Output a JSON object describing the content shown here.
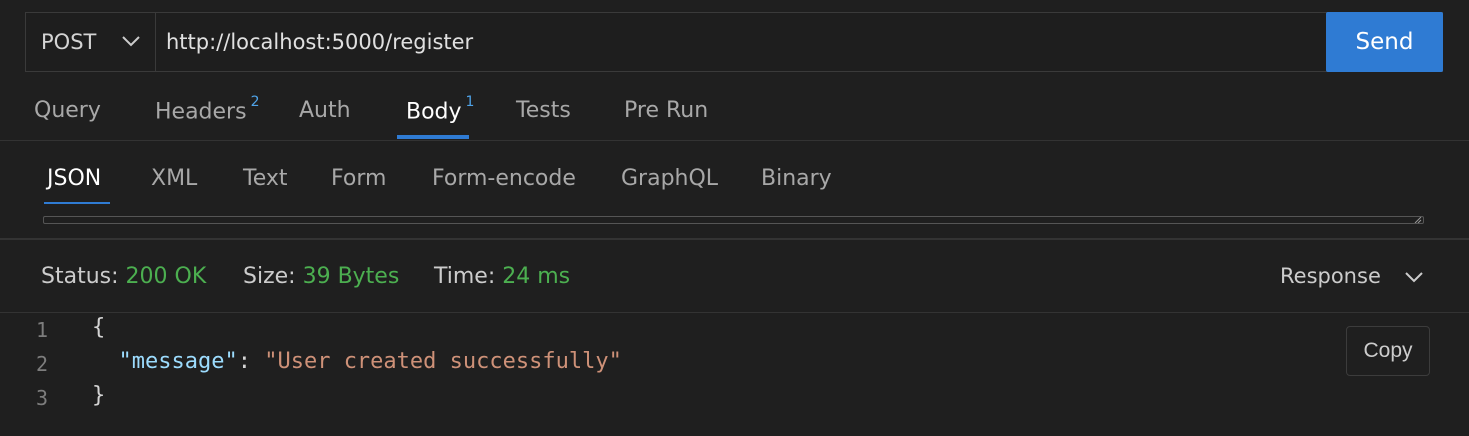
{
  "request": {
    "method": "POST",
    "url": "http://localhost:5000/register",
    "send_label": "Send"
  },
  "tabs": [
    {
      "label": "Query",
      "badge": ""
    },
    {
      "label": "Headers",
      "badge": "2"
    },
    {
      "label": "Auth",
      "badge": ""
    },
    {
      "label": "Body",
      "badge": "1"
    },
    {
      "label": "Tests",
      "badge": ""
    },
    {
      "label": "Pre Run",
      "badge": ""
    }
  ],
  "active_tab": "Body",
  "body_types": [
    "JSON",
    "XML",
    "Text",
    "Form",
    "Form-encode",
    "GraphQL",
    "Binary"
  ],
  "active_body_type": "JSON",
  "response": {
    "status_label": "Status:",
    "status_value": "200 OK",
    "size_label": "Size:",
    "size_value": "39 Bytes",
    "time_label": "Time:",
    "time_value": "24 ms",
    "view_select": "Response",
    "copy_label": "Copy",
    "lines": [
      {
        "num": "1",
        "brace": "{"
      },
      {
        "num": "2",
        "key": "\"message\"",
        "sep": ": ",
        "value": "\"User created successfully\""
      },
      {
        "num": "3",
        "brace": "}"
      }
    ]
  },
  "colors": {
    "accent": "#2f7bd3",
    "success": "#4caf50",
    "json_key": "#9cdcfe",
    "json_string": "#ce9178"
  }
}
